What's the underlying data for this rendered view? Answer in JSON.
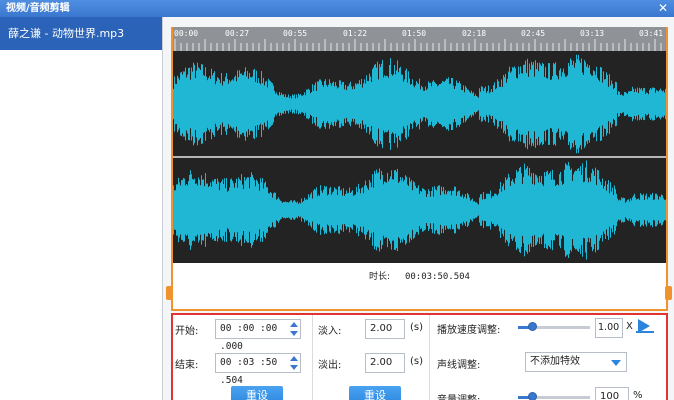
{
  "window": {
    "title": "视频/音频剪辑",
    "close_glyph": "✕"
  },
  "sidebar": {
    "items": [
      {
        "label": "薛之谦 - 动物世界.mp3",
        "selected": true
      }
    ]
  },
  "timeline": {
    "ticks": [
      "00:00",
      "00:27",
      "00:55",
      "01:22",
      "01:50",
      "02:18",
      "02:45",
      "03:13",
      "03:41"
    ],
    "duration_label": "时长:",
    "duration_value": "00:03:50.504"
  },
  "controls": {
    "start_label": "开始:",
    "start_value": "00 :00 :00 .000",
    "end_label": "结束:",
    "end_value": "00 :03 :50 .504",
    "reset_label_1": "重设",
    "fade_in_label": "淡入:",
    "fade_in_value": "2.00",
    "fade_in_unit": "(s)",
    "fade_out_label": "淡出:",
    "fade_out_value": "2.00",
    "fade_out_unit": "(s)",
    "reset_label_2": "重设",
    "speed_label": "播放速度调整:",
    "speed_value": "1.00",
    "speed_unit": "X",
    "speed_level": 0.2,
    "voice_label": "声线调整:",
    "voice_value": "不添加特效",
    "volume_label": "音量调整:",
    "volume_value": "100",
    "volume_unit": "%",
    "volume_level": 0.2
  },
  "colors": {
    "wave": "#1fb7d4",
    "wave_bg": "#232323",
    "accent": "#3a78d0",
    "highlight_border": "#e23333",
    "timeline_border": "#f0922e"
  }
}
